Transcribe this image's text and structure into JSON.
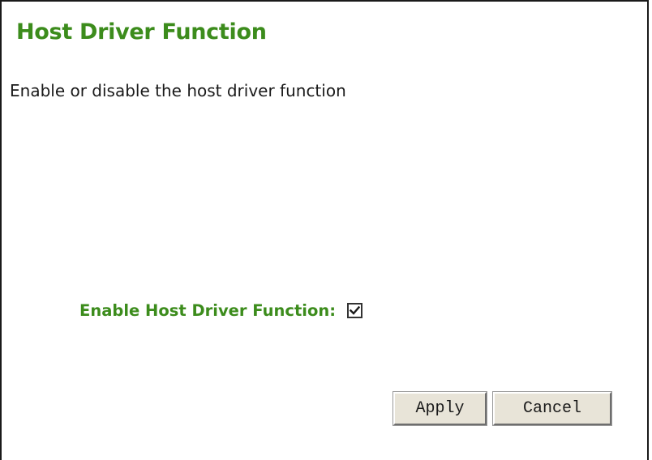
{
  "page": {
    "title": "Host Driver Function",
    "description": "Enable or disable the host driver function"
  },
  "form": {
    "enable_label": "Enable Host Driver Function:",
    "enable_checked": true
  },
  "buttons": {
    "apply_label": "Apply",
    "cancel_label": "Cancel"
  },
  "colors": {
    "heading": "#3c8c1c",
    "button_face": "#e8e4d8"
  },
  "icons": {
    "checkbox_mark": "checkmark-icon"
  }
}
